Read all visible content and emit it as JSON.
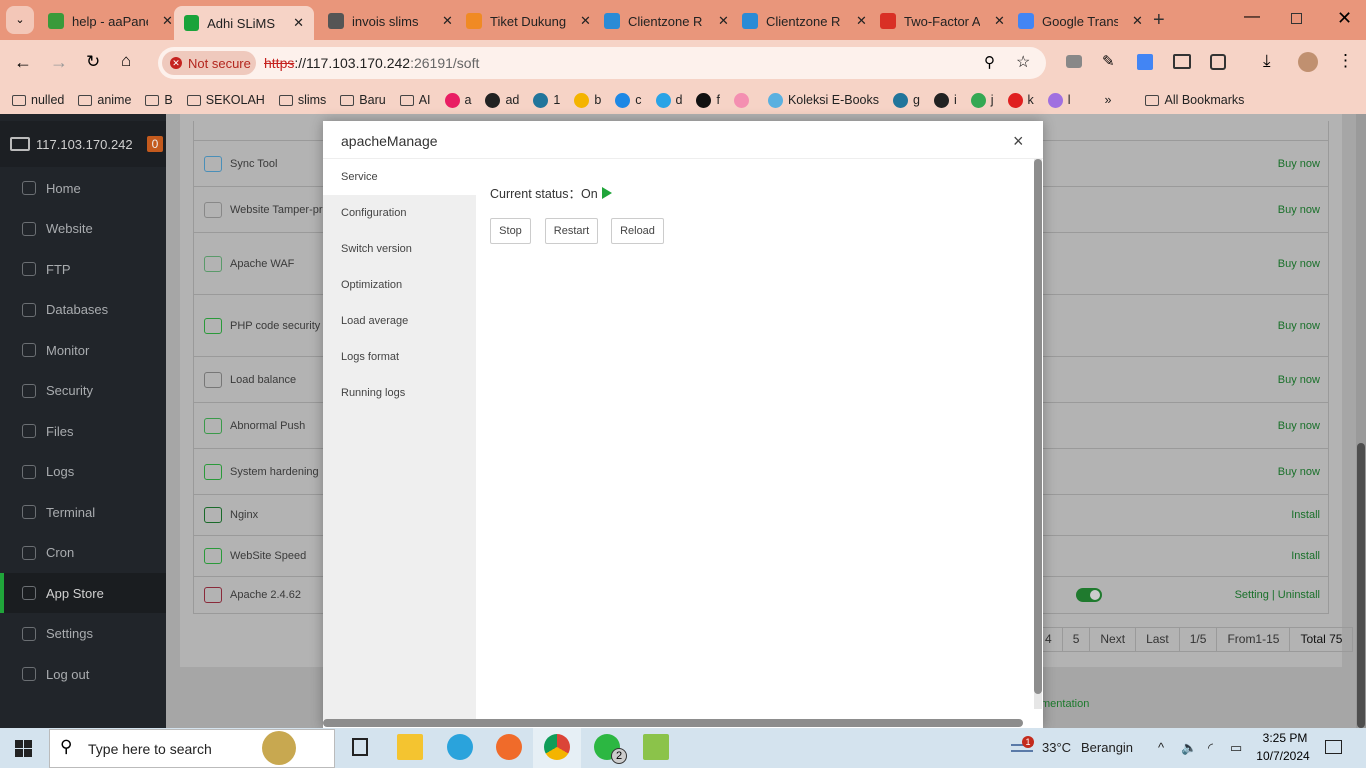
{
  "browser": {
    "tabs": [
      {
        "label": "help - aaPanel",
        "color": "#3a9a3a"
      },
      {
        "label": "Adhi SLiMS L",
        "color": "#1aa33a",
        "active": true
      },
      {
        "label": "invois slims",
        "color": "#555"
      },
      {
        "label": "Tiket Dukung",
        "color": "#f08a24"
      },
      {
        "label": "Clientzone R",
        "color": "#2a8bd6"
      },
      {
        "label": "Clientzone R",
        "color": "#2a8bd6"
      },
      {
        "label": "Two-Factor A",
        "color": "#d93025"
      },
      {
        "label": "Google Trans",
        "color": "#4285f4"
      }
    ],
    "security_chip": "Not secure",
    "url_scheme": "https",
    "url_host": "://117.103.170.242",
    "url_port_path": ":26191/soft",
    "bookmarks": [
      "nulled",
      "anime",
      "B",
      "SEKOLAH",
      "slims",
      "Baru",
      "AI",
      "a",
      "ad",
      "1",
      "b",
      "c",
      "d",
      "f",
      "",
      "Koleksi E-Books",
      "g",
      "i",
      "j",
      "k",
      "l"
    ],
    "all_bookmarks": "All Bookmarks",
    "overflow": "»"
  },
  "sidebar": {
    "host": "117.103.170.242",
    "badge": "0",
    "items": [
      "Home",
      "Website",
      "FTP",
      "Databases",
      "Monitor",
      "Security",
      "Files",
      "Logs",
      "Terminal",
      "Cron",
      "App Store",
      "Settings",
      "Log out"
    ],
    "active": "App Store"
  },
  "apps": [
    {
      "name": "Sync Tool",
      "action": "Buy now"
    },
    {
      "name": "Website Tamper-pro",
      "action": "Buy now"
    },
    {
      "name": "Apache WAF",
      "action": "Buy now"
    },
    {
      "name": "PHP code security",
      "action": "Buy now"
    },
    {
      "name": "Load balance",
      "action": "Buy now"
    },
    {
      "name": "Abnormal Push",
      "action": "Buy now"
    },
    {
      "name": "System hardening",
      "action": "Buy now"
    },
    {
      "name": "Nginx",
      "action": "Install"
    },
    {
      "name": "WebSite Speed",
      "action": "Install"
    },
    {
      "name": "Apache 2.4.62",
      "action": "Setting | Uninstall",
      "enabled": true
    }
  ],
  "pager": [
    "4",
    "5",
    "Next",
    "Last",
    "1/5",
    "From1-15",
    "Total 75"
  ],
  "footer_link": "mentation",
  "modal": {
    "title": "apacheManage",
    "close": "×",
    "menu": [
      "Service",
      "Configuration",
      "Switch version",
      "Optimization",
      "Load average",
      "Logs format",
      "Running logs"
    ],
    "active": "Service",
    "status_label": "Current status：",
    "status_value": "On",
    "buttons": {
      "stop": "Stop",
      "restart": "Restart",
      "reload": "Reload"
    }
  },
  "taskbar": {
    "search_placeholder": "Type here to search",
    "weather_temp": "33°C",
    "weather_desc": "Berangin",
    "weather_badge": "1",
    "whatsapp_badge": "2",
    "time": "3:25 PM",
    "date": "10/7/2024"
  }
}
